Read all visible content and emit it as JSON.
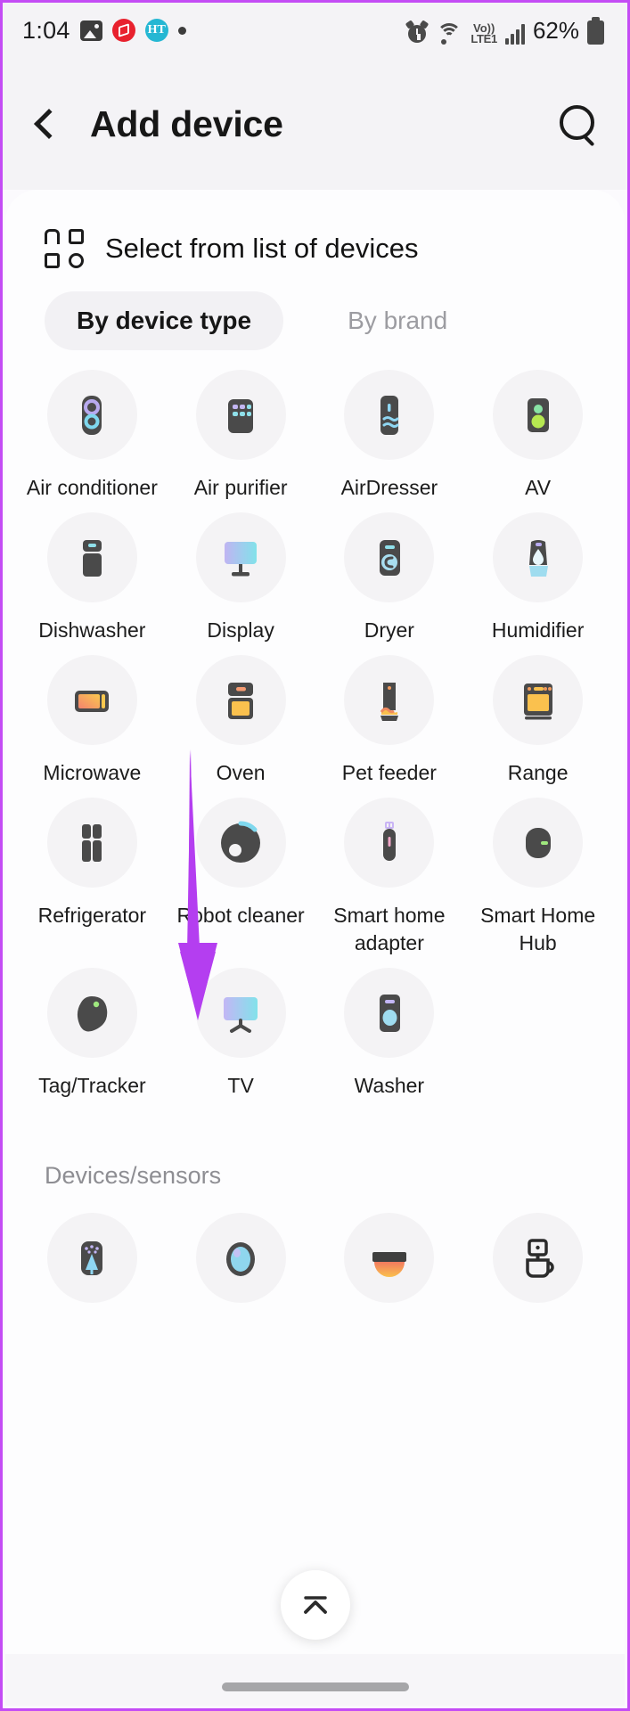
{
  "statusbar": {
    "time": "1:04",
    "icons_left": [
      "photos-icon",
      "red-app-icon",
      "ht-app-icon",
      "dot-icon"
    ],
    "ht_label": "HT",
    "icons_right": [
      "alarm-icon",
      "wifi-icon",
      "volte-icon",
      "signal-icon",
      "battery-icon"
    ],
    "volte_line1": "Vo))",
    "volte_line2": "LTE1",
    "battery": "62%"
  },
  "appbar": {
    "back_icon": "back-chevron-icon",
    "title": "Add device",
    "search_icon": "search-icon"
  },
  "section": {
    "icon": "device-grid-icon",
    "title": "Select from list of devices"
  },
  "tabs": [
    {
      "label": "By device type",
      "active": true
    },
    {
      "label": "By brand",
      "active": false
    }
  ],
  "devices": [
    {
      "label": "Air conditioner",
      "icon": "air-conditioner-icon"
    },
    {
      "label": "Air purifier",
      "icon": "air-purifier-icon"
    },
    {
      "label": "AirDresser",
      "icon": "airdresser-icon"
    },
    {
      "label": "AV",
      "icon": "av-icon"
    },
    {
      "label": "Dishwasher",
      "icon": "dishwasher-icon"
    },
    {
      "label": "Display",
      "icon": "display-icon"
    },
    {
      "label": "Dryer",
      "icon": "dryer-icon"
    },
    {
      "label": "Humidifier",
      "icon": "humidifier-icon"
    },
    {
      "label": "Microwave",
      "icon": "microwave-icon"
    },
    {
      "label": "Oven",
      "icon": "oven-icon"
    },
    {
      "label": "Pet feeder",
      "icon": "pet-feeder-icon"
    },
    {
      "label": "Range",
      "icon": "range-icon"
    },
    {
      "label": "Refrigerator",
      "icon": "refrigerator-icon"
    },
    {
      "label": "Robot cleaner",
      "icon": "robot-cleaner-icon"
    },
    {
      "label": "Smart home adapter",
      "icon": "smart-home-adapter-icon"
    },
    {
      "label": "Smart Home Hub",
      "icon": "smart-home-hub-icon"
    },
    {
      "label": "Tag/Tracker",
      "icon": "tag-tracker-icon"
    },
    {
      "label": "TV",
      "icon": "tv-icon"
    },
    {
      "label": "Washer",
      "icon": "washer-icon"
    }
  ],
  "section2": {
    "title": "Devices/sensors",
    "partial_items": [
      {
        "icon": "air-quality-icon"
      },
      {
        "icon": "camera-icon"
      },
      {
        "icon": "cooktop-icon"
      },
      {
        "icon": "coffee-maker-icon"
      }
    ]
  },
  "fab": {
    "icon": "collapse-chevron-up-icon"
  },
  "annotation": {
    "arrow_color": "#b43ef0",
    "icon": "arrow-down-annotation"
  }
}
